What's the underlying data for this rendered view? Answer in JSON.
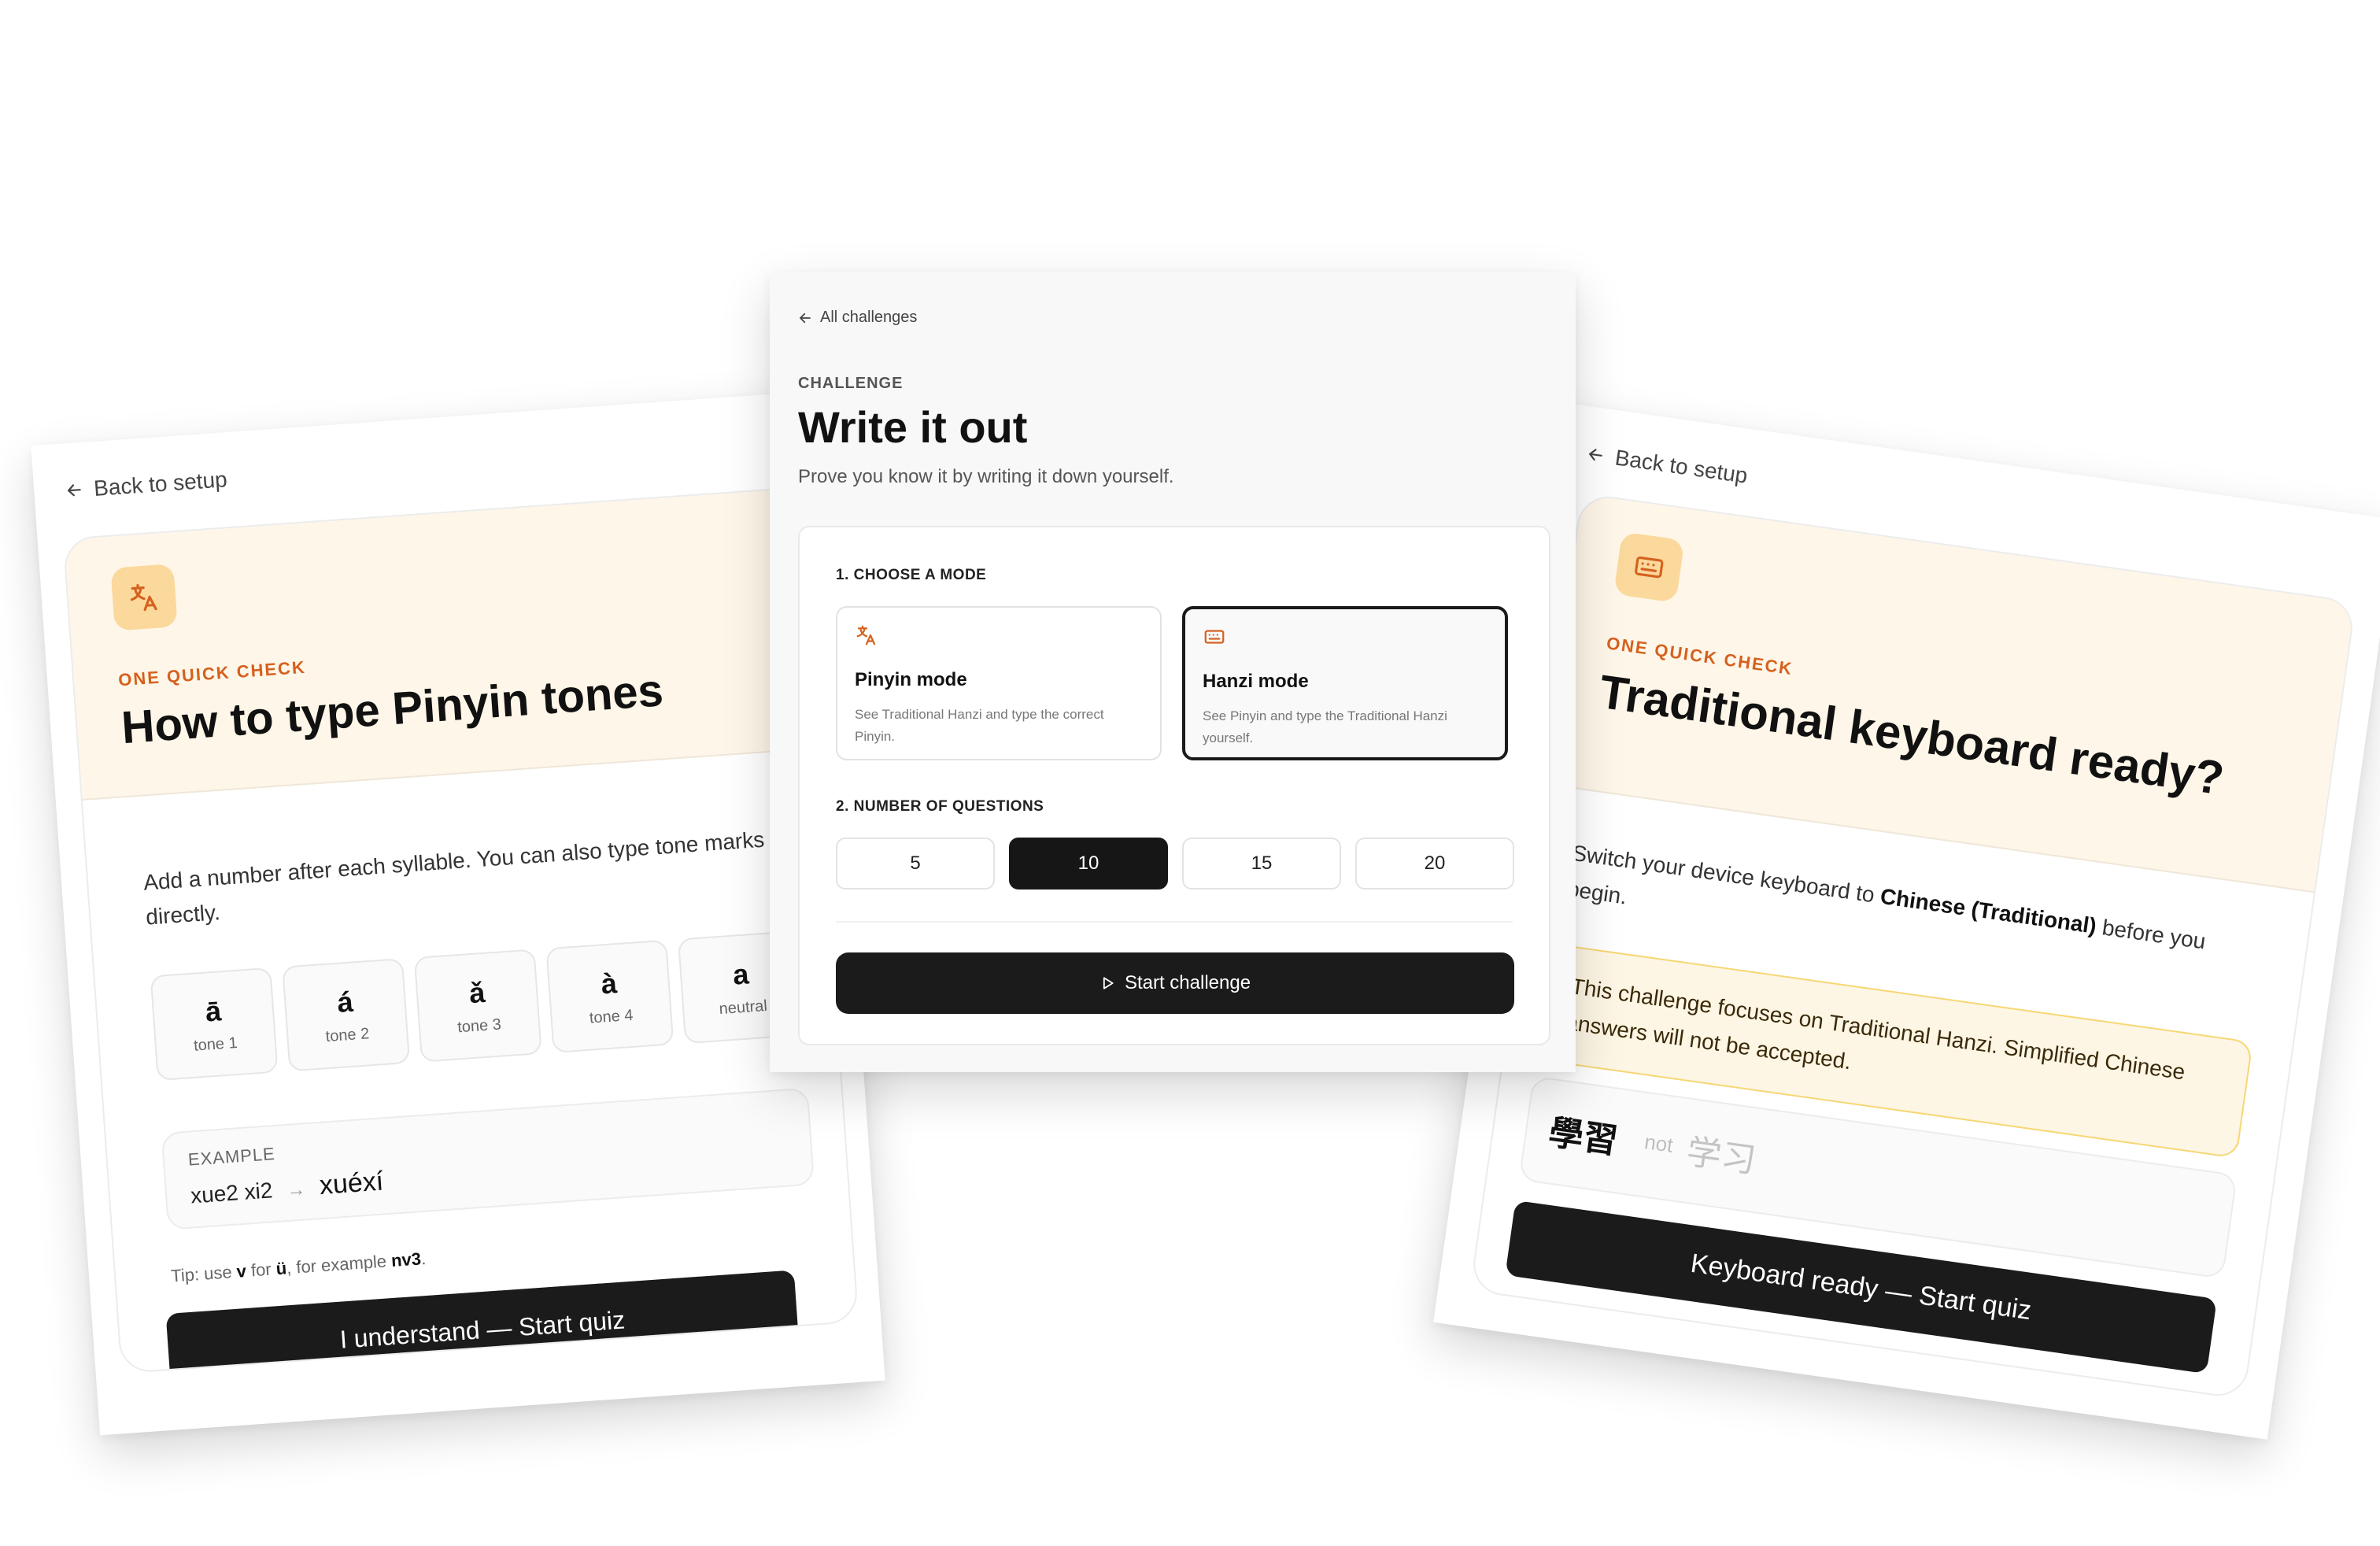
{
  "left_card": {
    "back_label": "Back to setup",
    "eyebrow": "ONE QUICK CHECK",
    "title": "How to type Pinyin tones",
    "description": "Add a number after each syllable. You can also type tone marks directly.",
    "tones": [
      {
        "glyph": "ā",
        "caption": "tone 1"
      },
      {
        "glyph": "á",
        "caption": "tone 2"
      },
      {
        "glyph": "ǎ",
        "caption": "tone 3"
      },
      {
        "glyph": "à",
        "caption": "tone 4"
      },
      {
        "glyph": "a",
        "caption": "neutral"
      }
    ],
    "example_label": "EXAMPLE",
    "example_input": "xue2 xi2",
    "example_arrow": "→",
    "example_output": "xuéxí",
    "tip_prefix": "Tip: use",
    "tip_v": "v",
    "tip_for": "for",
    "tip_u": "ü",
    "tip_example": ", for example",
    "tip_code": "nv3",
    "tip_end": ".",
    "button_label": "I understand — Start quiz"
  },
  "center_card": {
    "back_label": "All challenges",
    "eyebrow": "CHALLENGE",
    "title": "Write it out",
    "subtitle": "Prove you know it by writing it down yourself.",
    "mode_section_label": "1. CHOOSE A MODE",
    "modes": [
      {
        "name": "Pinyin mode",
        "description": "See Traditional Hanzi and type the correct Pinyin.",
        "icon": "translate-icon",
        "selected": false
      },
      {
        "name": "Hanzi mode",
        "description": "See Pinyin and type the Traditional Hanzi yourself.",
        "icon": "keyboard-icon",
        "selected": true
      }
    ],
    "count_section_label": "2. NUMBER OF QUESTIONS",
    "counts": [
      "5",
      "10",
      "15",
      "20"
    ],
    "selected_count": "10",
    "start_label": "Start challenge"
  },
  "right_card": {
    "back_label": "Back to setup",
    "eyebrow": "ONE QUICK CHECK",
    "title": "Traditional keyboard ready?",
    "desc_prefix": "Switch your device keyboard to",
    "desc_bold": "Chinese (Traditional)",
    "desc_suffix": "before you begin.",
    "warning": "This challenge focuses on Traditional Hanzi. Simplified Chinese answers will not be accepted.",
    "traditional_sample": "學習",
    "not_label": "not",
    "simplified_sample": "学习",
    "button_label": "Keyboard ready — Start quiz"
  },
  "colors": {
    "accent_orange": "#d5611e",
    "hero_cream": "#fef6e8",
    "icon_tile": "#fbd89c",
    "dark_button": "#1b1b1b",
    "warning_border": "#f6d774"
  }
}
